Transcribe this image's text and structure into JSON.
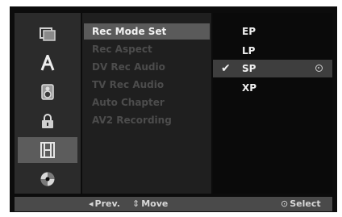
{
  "sidebar": {
    "items": [
      {
        "icon": "disc-copy-icon"
      },
      {
        "icon": "language-a-icon"
      },
      {
        "icon": "audio-speaker-icon"
      },
      {
        "icon": "lock-icon"
      },
      {
        "icon": "film-record-icon",
        "selected": true
      },
      {
        "icon": "disc-icon"
      }
    ]
  },
  "submenu": {
    "items": [
      {
        "label": "Rec Mode Set",
        "active": true
      },
      {
        "label": "Rec Aspect"
      },
      {
        "label": "DV Rec Audio"
      },
      {
        "label": "TV Rec Audio"
      },
      {
        "label": "Auto Chapter"
      },
      {
        "label": "AV2 Recording"
      }
    ]
  },
  "options": {
    "items": [
      {
        "label": "EP"
      },
      {
        "label": "LP"
      },
      {
        "label": "SP",
        "selected": true
      },
      {
        "label": "XP"
      }
    ],
    "checkmark": "✔"
  },
  "footer": {
    "prev_symbol": "◂",
    "prev_label": "Prev.",
    "move_symbol": "⇕",
    "move_label": "Move",
    "select_symbol": "⊙",
    "select_label": "Select"
  },
  "colors": {
    "screen_bg": "#0c0c0c",
    "sidebar_bg": "#2b2b2b",
    "highlight": "#5a5a5a",
    "inactive_text": "#4c4c4c",
    "active_text": "#f2f2f2"
  }
}
